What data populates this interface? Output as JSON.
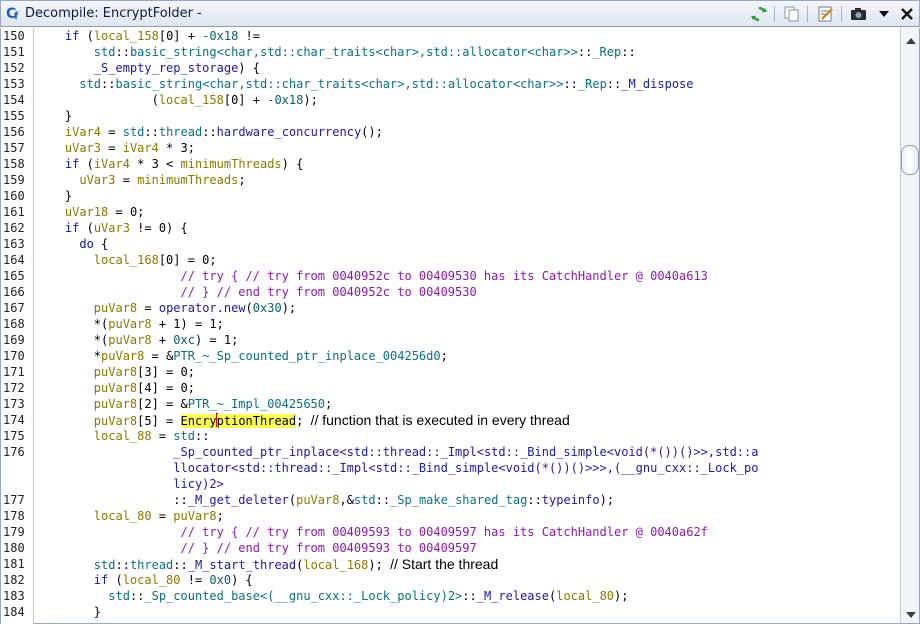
{
  "window": {
    "title": "Decompile: EncryptFolder -",
    "icon": "decompiler-icon",
    "icon_text": "C",
    "icon_sub": "f",
    "toolbar": [
      {
        "name": "refresh-icon"
      },
      {
        "name": "copy-icon"
      },
      {
        "name": "edit-signature-icon"
      },
      {
        "name": "snapshot-icon"
      },
      {
        "name": "menu-dropdown-icon"
      },
      {
        "name": "close-icon"
      }
    ]
  },
  "colors": {
    "keyword": "#0a1a9a",
    "variable": "#8a7a00",
    "function": "#1d1aa5",
    "type": "#0d6f82",
    "comment": "#8b1ab0",
    "highlight": "#ffff55",
    "cursor": "#e00000"
  },
  "editor": {
    "lines": [
      {
        "num": "150",
        "tokens": [
          [
            "pl",
            "    "
          ],
          [
            "kw",
            "if"
          ],
          [
            "pl",
            " ("
          ],
          [
            "var",
            "local_158"
          ],
          [
            "pl",
            "[0] + "
          ],
          [
            "lit",
            "-0x18"
          ],
          [
            "pl",
            " !="
          ]
        ]
      },
      {
        "num": "151",
        "tokens": [
          [
            "pl",
            "        "
          ],
          [
            "type",
            "std"
          ],
          [
            "pl",
            "::"
          ],
          [
            "type",
            "basic_string<char,std::char_traits<char>,std::allocator<char>>"
          ],
          [
            "pl",
            "::"
          ],
          [
            "type",
            "_Rep"
          ],
          [
            "pl",
            "::"
          ]
        ]
      },
      {
        "num": "152",
        "tokens": [
          [
            "pl",
            "        "
          ],
          [
            "fn",
            "_S_empty_rep_storage"
          ],
          [
            "pl",
            ") {"
          ]
        ]
      },
      {
        "num": "153",
        "tokens": [
          [
            "pl",
            "      "
          ],
          [
            "type",
            "std"
          ],
          [
            "pl",
            "::"
          ],
          [
            "type",
            "basic_string<char,std::char_traits<char>,std::allocator<char>>"
          ],
          [
            "pl",
            "::"
          ],
          [
            "type",
            "_Rep"
          ],
          [
            "pl",
            "::"
          ],
          [
            "fn",
            "_M_dispose"
          ]
        ]
      },
      {
        "num": "154",
        "tokens": [
          [
            "pl",
            "                ("
          ],
          [
            "var",
            "local_158"
          ],
          [
            "pl",
            "[0] + "
          ],
          [
            "lit",
            "-0x18"
          ],
          [
            "pl",
            ");"
          ]
        ]
      },
      {
        "num": "155",
        "tokens": [
          [
            "pl",
            "    }"
          ]
        ]
      },
      {
        "num": "156",
        "tokens": [
          [
            "pl",
            "    "
          ],
          [
            "var",
            "iVar4"
          ],
          [
            "pl",
            " = "
          ],
          [
            "type",
            "std"
          ],
          [
            "pl",
            "::"
          ],
          [
            "type",
            "thread"
          ],
          [
            "pl",
            "::"
          ],
          [
            "fn",
            "hardware_concurrency"
          ],
          [
            "pl",
            "();"
          ]
        ]
      },
      {
        "num": "157",
        "tokens": [
          [
            "pl",
            "    "
          ],
          [
            "var",
            "uVar3"
          ],
          [
            "pl",
            " = "
          ],
          [
            "var",
            "iVar4"
          ],
          [
            "pl",
            " * 3;"
          ]
        ]
      },
      {
        "num": "158",
        "tokens": [
          [
            "pl",
            "    "
          ],
          [
            "kw",
            "if"
          ],
          [
            "pl",
            " ("
          ],
          [
            "var",
            "iVar4"
          ],
          [
            "pl",
            " * 3 < "
          ],
          [
            "var",
            "minimumThreads"
          ],
          [
            "pl",
            ") {"
          ]
        ]
      },
      {
        "num": "159",
        "tokens": [
          [
            "pl",
            "      "
          ],
          [
            "var",
            "uVar3"
          ],
          [
            "pl",
            " = "
          ],
          [
            "var",
            "minimumThreads"
          ],
          [
            "pl",
            ";"
          ]
        ]
      },
      {
        "num": "160",
        "tokens": [
          [
            "pl",
            "    }"
          ]
        ]
      },
      {
        "num": "161",
        "tokens": [
          [
            "pl",
            "    "
          ],
          [
            "var",
            "uVar18"
          ],
          [
            "pl",
            " = 0;"
          ]
        ]
      },
      {
        "num": "162",
        "tokens": [
          [
            "pl",
            "    "
          ],
          [
            "kw",
            "if"
          ],
          [
            "pl",
            " ("
          ],
          [
            "var",
            "uVar3"
          ],
          [
            "pl",
            " != 0) {"
          ]
        ]
      },
      {
        "num": "163",
        "tokens": [
          [
            "pl",
            "      "
          ],
          [
            "kw",
            "do"
          ],
          [
            "pl",
            " {"
          ]
        ]
      },
      {
        "num": "164",
        "tokens": [
          [
            "pl",
            "        "
          ],
          [
            "var",
            "local_168"
          ],
          [
            "pl",
            "[0] = 0;"
          ]
        ]
      },
      {
        "num": "165",
        "tokens": [
          [
            "pl",
            "                    "
          ],
          [
            "cm",
            "// try { // try from 0040952c to 00409530 has its CatchHandler @ 0040a613"
          ]
        ]
      },
      {
        "num": "166",
        "tokens": [
          [
            "pl",
            "                    "
          ],
          [
            "cm",
            "// } // end try from 0040952c to 00409530"
          ]
        ]
      },
      {
        "num": "167",
        "tokens": [
          [
            "pl",
            "        "
          ],
          [
            "var",
            "puVar8"
          ],
          [
            "pl",
            " = "
          ],
          [
            "fn",
            "operator.new"
          ],
          [
            "pl",
            "("
          ],
          [
            "lit",
            "0x30"
          ],
          [
            "pl",
            ");"
          ]
        ]
      },
      {
        "num": "168",
        "tokens": [
          [
            "pl",
            "        *("
          ],
          [
            "var",
            "puVar8"
          ],
          [
            "pl",
            " + 1) = 1;"
          ]
        ]
      },
      {
        "num": "169",
        "tokens": [
          [
            "pl",
            "        *("
          ],
          [
            "var",
            "puVar8"
          ],
          [
            "pl",
            " + "
          ],
          [
            "lit",
            "0xc"
          ],
          [
            "pl",
            ") = 1;"
          ]
        ]
      },
      {
        "num": "170",
        "tokens": [
          [
            "pl",
            "        *"
          ],
          [
            "var",
            "puVar8"
          ],
          [
            "pl",
            " = &"
          ],
          [
            "type",
            "PTR_~_Sp_counted_ptr_inplace_004256d0"
          ],
          [
            "pl",
            ";"
          ]
        ]
      },
      {
        "num": "171",
        "tokens": [
          [
            "pl",
            "        "
          ],
          [
            "var",
            "puVar8"
          ],
          [
            "pl",
            "[3] = 0;"
          ]
        ]
      },
      {
        "num": "172",
        "tokens": [
          [
            "pl",
            "        "
          ],
          [
            "var",
            "puVar8"
          ],
          [
            "pl",
            "[4] = 0;"
          ]
        ]
      },
      {
        "num": "173",
        "tokens": [
          [
            "pl",
            "        "
          ],
          [
            "var",
            "puVar8"
          ],
          [
            "pl",
            "[2] = &"
          ],
          [
            "type",
            "PTR_~_Impl_00425650"
          ],
          [
            "pl",
            ";"
          ]
        ]
      },
      {
        "num": "174",
        "tokens": [
          [
            "pl",
            "        "
          ],
          [
            "var",
            "puVar8"
          ],
          [
            "pl",
            "[5] = "
          ],
          [
            "hl",
            "Encry"
          ],
          [
            "cursor",
            ""
          ],
          [
            "hl",
            "ptionThread"
          ],
          [
            "pl",
            "; "
          ],
          [
            "note",
            "// function that is executed in every thread"
          ]
        ]
      },
      {
        "num": "175",
        "tokens": [
          [
            "pl",
            "        "
          ],
          [
            "var",
            "local_88"
          ],
          [
            "pl",
            " = "
          ],
          [
            "type",
            "std"
          ],
          [
            "pl",
            "::"
          ]
        ]
      },
      {
        "num": "176",
        "tokens": [
          [
            "pl",
            "                   "
          ],
          [
            "fn",
            "_Sp_counted_ptr_inplace<std::thread::_Impl<std::_Bind_simple<void(*())()>>,std::a"
          ]
        ]
      },
      {
        "num": "",
        "tokens": [
          [
            "pl",
            "                   "
          ],
          [
            "fn",
            "llocator<std::thread::_Impl<std::_Bind_simple<void(*())()>>>,(__gnu_cxx::_Lock_po"
          ]
        ]
      },
      {
        "num": "",
        "tokens": [
          [
            "pl",
            "                   "
          ],
          [
            "fn",
            "licy)2>"
          ]
        ]
      },
      {
        "num": "177",
        "tokens": [
          [
            "pl",
            "                   ::"
          ],
          [
            "fn",
            "_M_get_deleter"
          ],
          [
            "pl",
            "("
          ],
          [
            "var",
            "puVar8"
          ],
          [
            "pl",
            ",&"
          ],
          [
            "type",
            "std"
          ],
          [
            "pl",
            "::"
          ],
          [
            "type",
            "_Sp_make_shared_tag"
          ],
          [
            "pl",
            "::"
          ],
          [
            "fn",
            "typeinfo"
          ],
          [
            "pl",
            ");"
          ]
        ]
      },
      {
        "num": "178",
        "tokens": [
          [
            "pl",
            "        "
          ],
          [
            "var",
            "local_80"
          ],
          [
            "pl",
            " = "
          ],
          [
            "var",
            "puVar8"
          ],
          [
            "pl",
            ";"
          ]
        ]
      },
      {
        "num": "179",
        "tokens": [
          [
            "pl",
            "                    "
          ],
          [
            "cm",
            "// try { // try from 00409593 to 00409597 has its CatchHandler @ 0040a62f"
          ]
        ]
      },
      {
        "num": "180",
        "tokens": [
          [
            "pl",
            "                    "
          ],
          [
            "cm",
            "// } // end try from 00409593 to 00409597"
          ]
        ]
      },
      {
        "num": "181",
        "tokens": [
          [
            "pl",
            "        "
          ],
          [
            "type",
            "std"
          ],
          [
            "pl",
            "::"
          ],
          [
            "type",
            "thread"
          ],
          [
            "pl",
            "::"
          ],
          [
            "fn",
            "_M_start_thread"
          ],
          [
            "pl",
            "("
          ],
          [
            "var",
            "local_168"
          ],
          [
            "pl",
            "); "
          ],
          [
            "note",
            "// Start the thread"
          ]
        ]
      },
      {
        "num": "182",
        "tokens": [
          [
            "pl",
            "        "
          ],
          [
            "kw",
            "if"
          ],
          [
            "pl",
            " ("
          ],
          [
            "var",
            "local_80"
          ],
          [
            "pl",
            " != "
          ],
          [
            "lit",
            "0x0"
          ],
          [
            "pl",
            ") {"
          ]
        ]
      },
      {
        "num": "183",
        "tokens": [
          [
            "pl",
            "          "
          ],
          [
            "type",
            "std"
          ],
          [
            "pl",
            "::"
          ],
          [
            "type",
            "_Sp_counted_base<(__gnu_cxx::_Lock_policy)2>"
          ],
          [
            "pl",
            "::"
          ],
          [
            "fn",
            "_M_release"
          ],
          [
            "pl",
            "("
          ],
          [
            "var",
            "local_80"
          ],
          [
            "pl",
            ");"
          ]
        ]
      },
      {
        "num": "184",
        "tokens": [
          [
            "pl",
            "        }"
          ]
        ]
      }
    ]
  },
  "scrollbar": {
    "position_fraction": 0.21
  }
}
